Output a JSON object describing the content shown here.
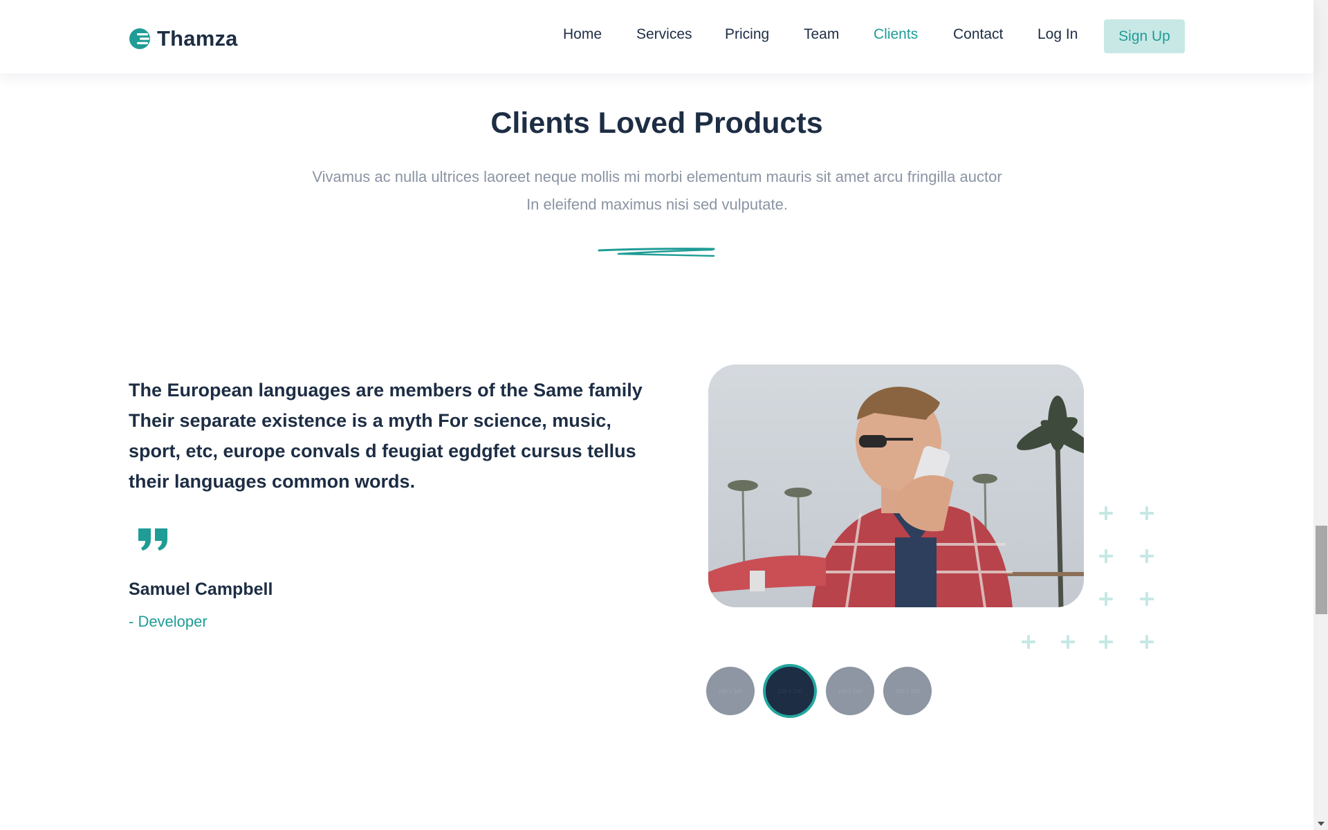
{
  "brand": {
    "name": "Thamza",
    "logo_icon": "brand-logo-icon",
    "accent_color": "#1f9c96"
  },
  "nav": {
    "items": [
      {
        "label": "Home",
        "active": false
      },
      {
        "label": "Services",
        "active": false
      },
      {
        "label": "Pricing",
        "active": false
      },
      {
        "label": "Team",
        "active": false
      },
      {
        "label": "Clients",
        "active": true
      },
      {
        "label": "Contact",
        "active": false
      },
      {
        "label": "Log In",
        "active": false
      }
    ],
    "signup_label": "Sign Up"
  },
  "section": {
    "title": "Clients Loved Products",
    "description": "Vivamus ac nulla ultrices laoreet neque mollis mi morbi elementum mauris sit amet arcu fringilla auctor In eleifend maximus nisi sed vulputate."
  },
  "testimonial": {
    "quote": "The European languages are members of the Same family Their separate existence is a myth For science, music, sport, etc, europe convals d feugiat egdgfet cursus tellus their languages common words.",
    "quote_icon": "quote-icon",
    "author_name": "Samuel Campbell",
    "author_role": "- Developer"
  },
  "thumbnails": [
    {
      "label": "100 x 100",
      "active": false
    },
    {
      "label": "100 x 100",
      "active": true
    },
    {
      "label": "100 x 100",
      "active": false
    },
    {
      "label": "100 x 100",
      "active": false
    }
  ],
  "colors": {
    "heading": "#1d2d44",
    "muted_text": "#8a94a3",
    "accent": "#1f9c96",
    "signup_bg": "#c8e8e6",
    "plus_decoration": "#c6e8e5"
  }
}
